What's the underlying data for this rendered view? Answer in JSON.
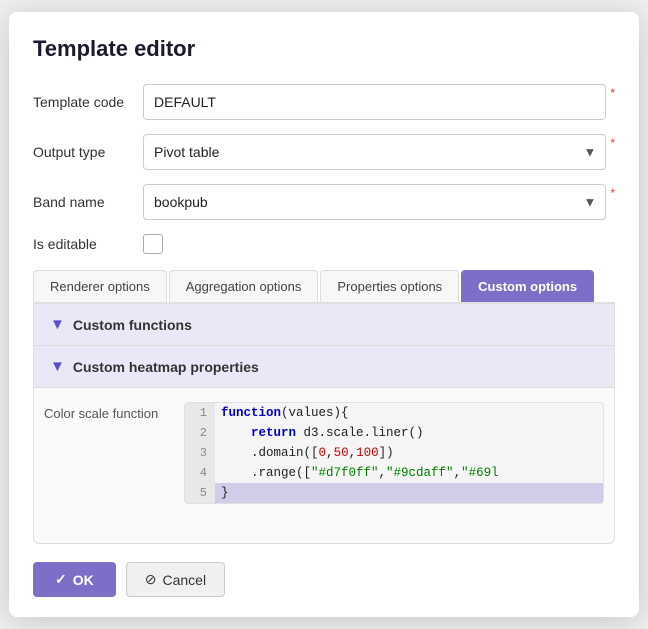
{
  "dialog": {
    "title": "Template editor"
  },
  "form": {
    "template_code_label": "Template code",
    "template_code_value": "DEFAULT",
    "output_type_label": "Output type",
    "output_type_value": "Pivot table",
    "band_name_label": "Band name",
    "band_name_value": "bookpub",
    "is_editable_label": "Is editable"
  },
  "tabs": [
    {
      "label": "Renderer options",
      "active": false
    },
    {
      "label": "Aggregation options",
      "active": false
    },
    {
      "label": "Properties options",
      "active": false
    },
    {
      "label": "Custom options",
      "active": true
    }
  ],
  "custom_functions_section": {
    "label": "Custom functions"
  },
  "custom_heatmap_section": {
    "label": "Custom heatmap properties"
  },
  "color_scale": {
    "label": "Color scale function",
    "lines": [
      {
        "number": "1",
        "code": "function(values){",
        "highlighted": false
      },
      {
        "number": "2",
        "code": "    return d3.scale.liner()",
        "highlighted": false
      },
      {
        "number": "3",
        "code": "    .domain([0,50,100])",
        "highlighted": false
      },
      {
        "number": "4",
        "code": "    .range([\"#d7f0ff\",\"#9cdaff\",\"#69l",
        "highlighted": false
      },
      {
        "number": "5",
        "code": "}",
        "highlighted": true
      }
    ]
  },
  "footer": {
    "ok_label": "OK",
    "cancel_label": "Cancel",
    "ok_icon": "✓",
    "cancel_icon": "⊘"
  }
}
